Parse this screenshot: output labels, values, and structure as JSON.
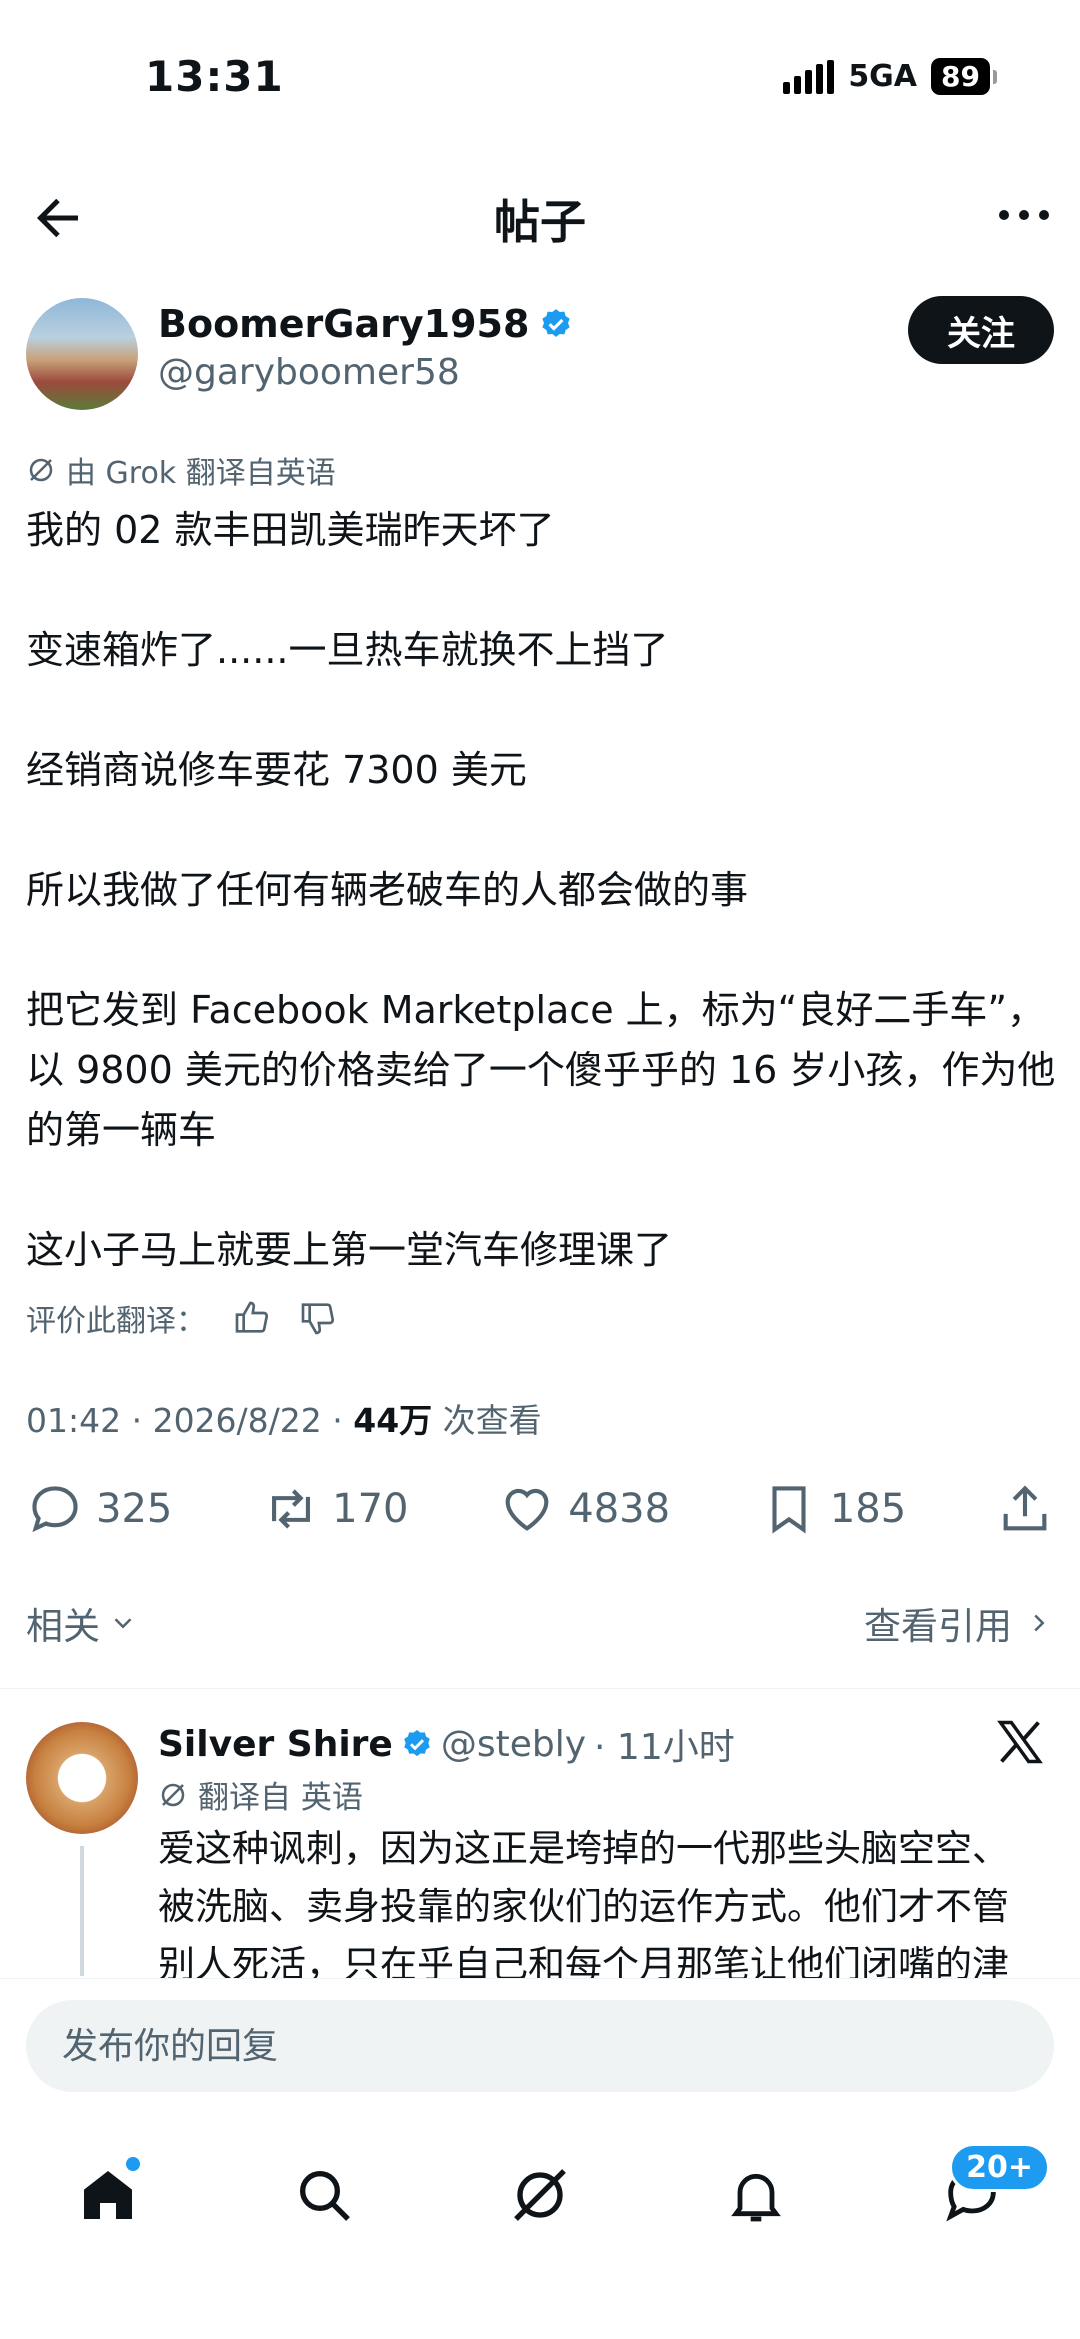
{
  "status_bar": {
    "time": "13:31",
    "network": "5GA",
    "battery": "89"
  },
  "header": {
    "title": "帖子"
  },
  "author": {
    "display_name": "BoomerGary1958",
    "handle": "@garyboomer58",
    "follow_label": "关注"
  },
  "post": {
    "translate_note": "由 Grok 翻译自英语",
    "paragraphs": [
      "我的 02 款丰田凯美瑞昨天坏了",
      "变速箱炸了......一旦热车就换不上挡了",
      "经销商说修车要花 7300 美元",
      "所以我做了任何有辆老破车的人都会做的事",
      "把它发到 Facebook Marketplace 上，标为“良好二手车”，以 9800 美元的价格卖给了一个傻乎乎的 16 岁小孩，作为他的第一辆车",
      "这小子马上就要上第一堂汽车修理课了"
    ],
    "rate_label": "评价此翻译：",
    "meta_time": "01:42 · 2026/8/22 · ",
    "meta_views": "44万",
    "meta_views_label": " 次查看"
  },
  "actions": {
    "replies": "325",
    "reposts": "170",
    "likes": "4838",
    "bookmarks": "185"
  },
  "links": {
    "related": "相关",
    "view_quotes": "查看引用"
  },
  "reply": {
    "display_name": "Silver Shire",
    "handle": "@stebly",
    "time": "· 11小时",
    "translate_note": "翻译自 英语",
    "text": "爱这种讽刺，因为这正是垮掉的一代那些头脑空空、被洗脑、卖身投靠的家伙们的运作方式。他们才不管别人死活，只在乎自己和每个月那笔让他们闭嘴的津"
  },
  "composer": {
    "placeholder": "发布你的回复"
  },
  "nav": {
    "messages_badge": "20+"
  },
  "colors": {
    "accent": "#1d9bf0",
    "text": "#0f1419",
    "secondary": "#536471"
  }
}
